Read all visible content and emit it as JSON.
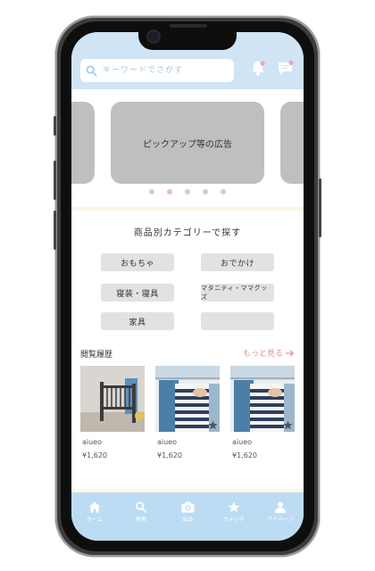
{
  "search": {
    "placeholder": "キーワードでさがす"
  },
  "carousel": {
    "center_label": "ピックアップ等の広告",
    "active_index": 1,
    "dot_count": 5
  },
  "categories": {
    "title": "商品別カテゴリーで探す",
    "items": [
      "おもちゃ",
      "おでかけ",
      "寝装・寝具",
      "マタニティ・ママグッズ",
      "家具",
      ""
    ]
  },
  "history": {
    "title": "閲覧履歴",
    "more_label": "もっと見る",
    "items": [
      {
        "name": "aiueo",
        "price": "¥1,620"
      },
      {
        "name": "aiueo",
        "price": "¥1,620"
      },
      {
        "name": "aiueo",
        "price": "¥1,620"
      }
    ]
  },
  "tabbar": {
    "items": [
      {
        "label": "ホーム",
        "icon": "home-icon"
      },
      {
        "label": "検索",
        "icon": "search-icon"
      },
      {
        "label": "出品",
        "icon": "camera-icon"
      },
      {
        "label": "ウォッチ",
        "icon": "star-icon"
      },
      {
        "label": "マイページ",
        "icon": "person-icon"
      }
    ]
  },
  "colors": {
    "header": "#cfe4f5",
    "tabbar": "#bcdcf4",
    "accent": "#e98aa6",
    "dot_active": "#f0b8c2"
  }
}
